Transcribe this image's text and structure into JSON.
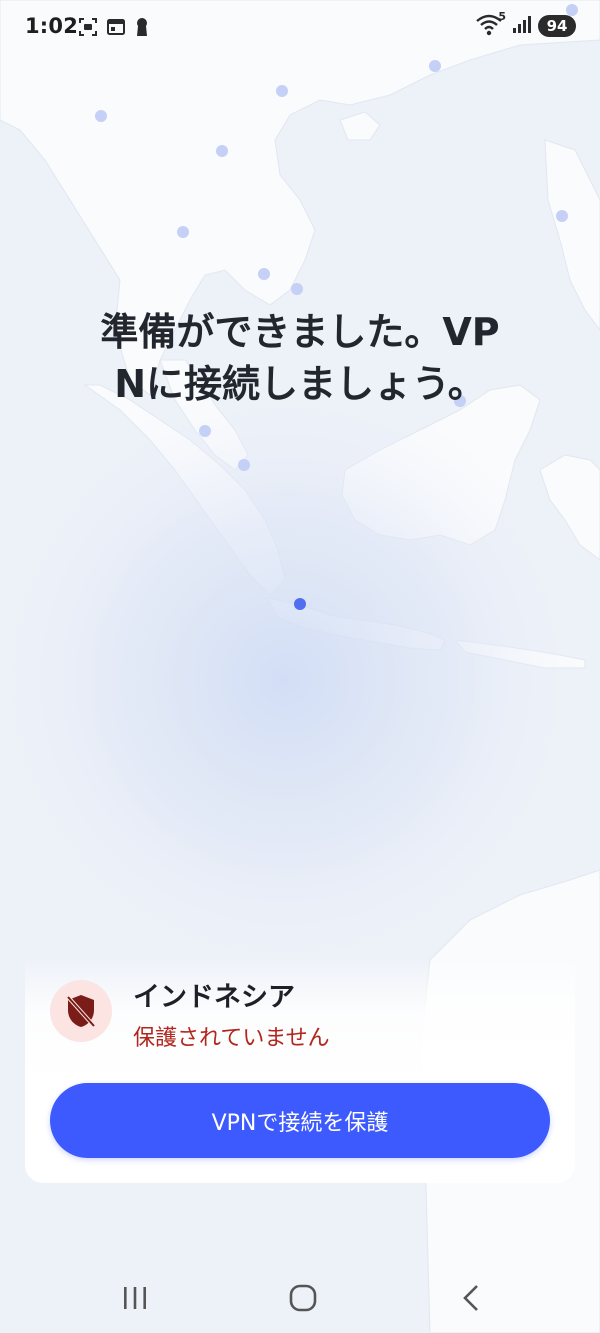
{
  "status_bar": {
    "time": "1:02",
    "battery": "94",
    "wifi_badge": "5",
    "icons_left": [
      "screenshot-icon",
      "calendar-icon",
      "keyhole-icon"
    ],
    "icons_right": [
      "wifi-icon",
      "signal-icon",
      "battery-icon"
    ]
  },
  "headline": "準備ができました。VPNに接続しましょう。",
  "location": {
    "country": "インドネシア",
    "status": "保護されていません",
    "icon": "shield-off-icon"
  },
  "connect_button": {
    "label": "VPNで接続を保護"
  },
  "navigation": {
    "icons": [
      "recents-icon",
      "home-icon",
      "back-icon"
    ]
  },
  "colors": {
    "accent": "#3d5afe",
    "danger": "#b3261e",
    "danger_bg": "#fce4e2",
    "map_water": "#edf1f8",
    "map_land": "#fafbfd",
    "server_dot": "#c4d0f5",
    "active_dot": "#4f6ff0"
  }
}
